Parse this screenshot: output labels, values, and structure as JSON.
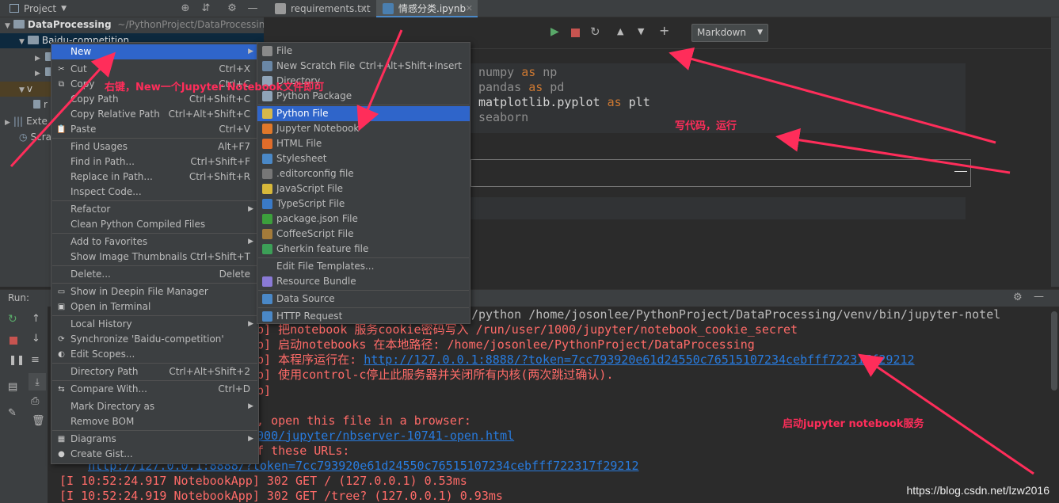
{
  "project_panel": {
    "title": "Project",
    "tree": [
      {
        "label": "DataProcessing",
        "path": "~/PythonProject/DataProcessing"
      },
      {
        "label": "Baidu-competition"
      },
      {
        "label": "v"
      },
      {
        "label": "r"
      },
      {
        "label": "Exte"
      },
      {
        "label": "Scra"
      }
    ]
  },
  "tabs": [
    {
      "label": "requirements.txt"
    },
    {
      "label": "情感分类.ipynb"
    }
  ],
  "notebook": {
    "cell_type": "Markdown",
    "code_lines": [
      "numpy as np",
      "pandas as pd",
      "matplotlib.pyplot as plt",
      "seaborn"
    ],
    "code_as_keyword": "as"
  },
  "context_menu": {
    "items": [
      {
        "label": "New",
        "shortcut": "",
        "submenu": true
      },
      {
        "label": "Cut",
        "shortcut": "Ctrl+X"
      },
      {
        "label": "Copy",
        "shortcut": "Ctrl+C"
      },
      {
        "label": "Copy Path",
        "shortcut": "Ctrl+Shift+C"
      },
      {
        "label": "Copy Relative Path",
        "shortcut": "Ctrl+Alt+Shift+C"
      },
      {
        "label": "Paste",
        "shortcut": "Ctrl+V"
      },
      {
        "label": "Find Usages",
        "shortcut": "Alt+F7"
      },
      {
        "label": "Find in Path...",
        "shortcut": "Ctrl+Shift+F"
      },
      {
        "label": "Replace in Path...",
        "shortcut": "Ctrl+Shift+R"
      },
      {
        "label": "Inspect Code...",
        "shortcut": ""
      },
      {
        "label": "Refactor",
        "shortcut": "",
        "submenu": true
      },
      {
        "label": "Clean Python Compiled Files",
        "shortcut": ""
      },
      {
        "label": "Add to Favorites",
        "shortcut": "",
        "submenu": true
      },
      {
        "label": "Show Image Thumbnails",
        "shortcut": "Ctrl+Shift+T"
      },
      {
        "label": "Delete...",
        "shortcut": "Delete"
      },
      {
        "label": "Show in Deepin File Manager",
        "shortcut": ""
      },
      {
        "label": "Open in Terminal",
        "shortcut": ""
      },
      {
        "label": "Local History",
        "shortcut": "",
        "submenu": true
      },
      {
        "label": "Synchronize 'Baidu-competition'",
        "shortcut": ""
      },
      {
        "label": "Edit Scopes...",
        "shortcut": ""
      },
      {
        "label": "Directory Path",
        "shortcut": "Ctrl+Alt+Shift+2"
      },
      {
        "label": "Compare With...",
        "shortcut": "Ctrl+D"
      },
      {
        "label": "Mark Directory as",
        "shortcut": "",
        "submenu": true
      },
      {
        "label": "Remove BOM",
        "shortcut": ""
      },
      {
        "label": "Diagrams",
        "shortcut": "",
        "submenu": true
      },
      {
        "label": "Create Gist...",
        "shortcut": ""
      }
    ]
  },
  "new_submenu": {
    "items": [
      {
        "label": "File",
        "shortcut": ""
      },
      {
        "label": "New Scratch File",
        "shortcut": "Ctrl+Alt+Shift+Insert"
      },
      {
        "label": "Directory",
        "shortcut": ""
      },
      {
        "label": "Python Package",
        "shortcut": ""
      },
      {
        "label": "Python File",
        "shortcut": ""
      },
      {
        "label": "Jupyter Notebook",
        "shortcut": ""
      },
      {
        "label": "HTML File",
        "shortcut": ""
      },
      {
        "label": "Stylesheet",
        "shortcut": ""
      },
      {
        "label": ".editorconfig file",
        "shortcut": ""
      },
      {
        "label": "JavaScript File",
        "shortcut": ""
      },
      {
        "label": "TypeScript File",
        "shortcut": ""
      },
      {
        "label": "package.json File",
        "shortcut": ""
      },
      {
        "label": "CoffeeScript File",
        "shortcut": ""
      },
      {
        "label": "Gherkin feature file",
        "shortcut": ""
      },
      {
        "label": "Edit File Templates...",
        "shortcut": ""
      },
      {
        "label": "Resource Bundle",
        "shortcut": ""
      },
      {
        "label": "Data Source",
        "shortcut": ""
      },
      {
        "label": "HTTP Request",
        "shortcut": ""
      }
    ]
  },
  "run_panel": {
    "title": "Run:",
    "lines": [
      {
        "text": "/python /home/josonlee/PythonProject/DataProcessing/venv/bin/jupyter-notel",
        "style": "normal"
      },
      {
        "text": "pp] 把notebook 服务cookie密码写入 /run/user/1000/jupyter/notebook_cookie_secret",
        "style": "red"
      },
      {
        "text": "pp] 启动notebooks 在本地路径: /home/josonlee/PythonProject/DataProcessing",
        "style": "red"
      },
      {
        "text": "pp] 本程序运行在: ",
        "link": "http://127.0.0.1:8888/?token=7cc793920e61d24550c76515107234cebfff722317f29212",
        "style": "red"
      },
      {
        "text": "pp] 使用control-c停止此服务器并关闭所有内核(两次跳过确认).",
        "style": "red"
      },
      {
        "text": "pp]",
        "style": "red"
      },
      {
        "text": "",
        "style": "normal"
      },
      {
        "text": "k, open this file in a browser:",
        "style": "red"
      },
      {
        "text": "",
        "link": "1000/jupyter/nbserver-10741-open.html",
        "style": "red"
      },
      {
        "text": "of these URLs:",
        "style": "red"
      },
      {
        "text": "    ",
        "link": "http://127.0.0.1:8888/?token=7cc793920e61d24550c76515107234cebfff722317f29212",
        "style": "red"
      },
      {
        "text": "[I 10:52:24.917 NotebookApp] 302 GET / (127.0.0.1) 0.53ms",
        "style": "red"
      },
      {
        "text": "[I 10:52:24.919 NotebookApp] 302 GET /tree? (127.0.0.1) 0.93ms",
        "style": "red"
      }
    ]
  },
  "annotations": {
    "right_click": "右键，New一个Jupyter Notebook文件即可",
    "write_code": "写代码，运行",
    "start_service": "启动jupyter notebook服务"
  },
  "watermark": "https://blog.csdn.net/lzw2016",
  "colors": {
    "menu_highlight": "#2f65ca",
    "annotation": "#ff2d5a",
    "console_red": "#ff6b68",
    "link": "#287bde"
  }
}
